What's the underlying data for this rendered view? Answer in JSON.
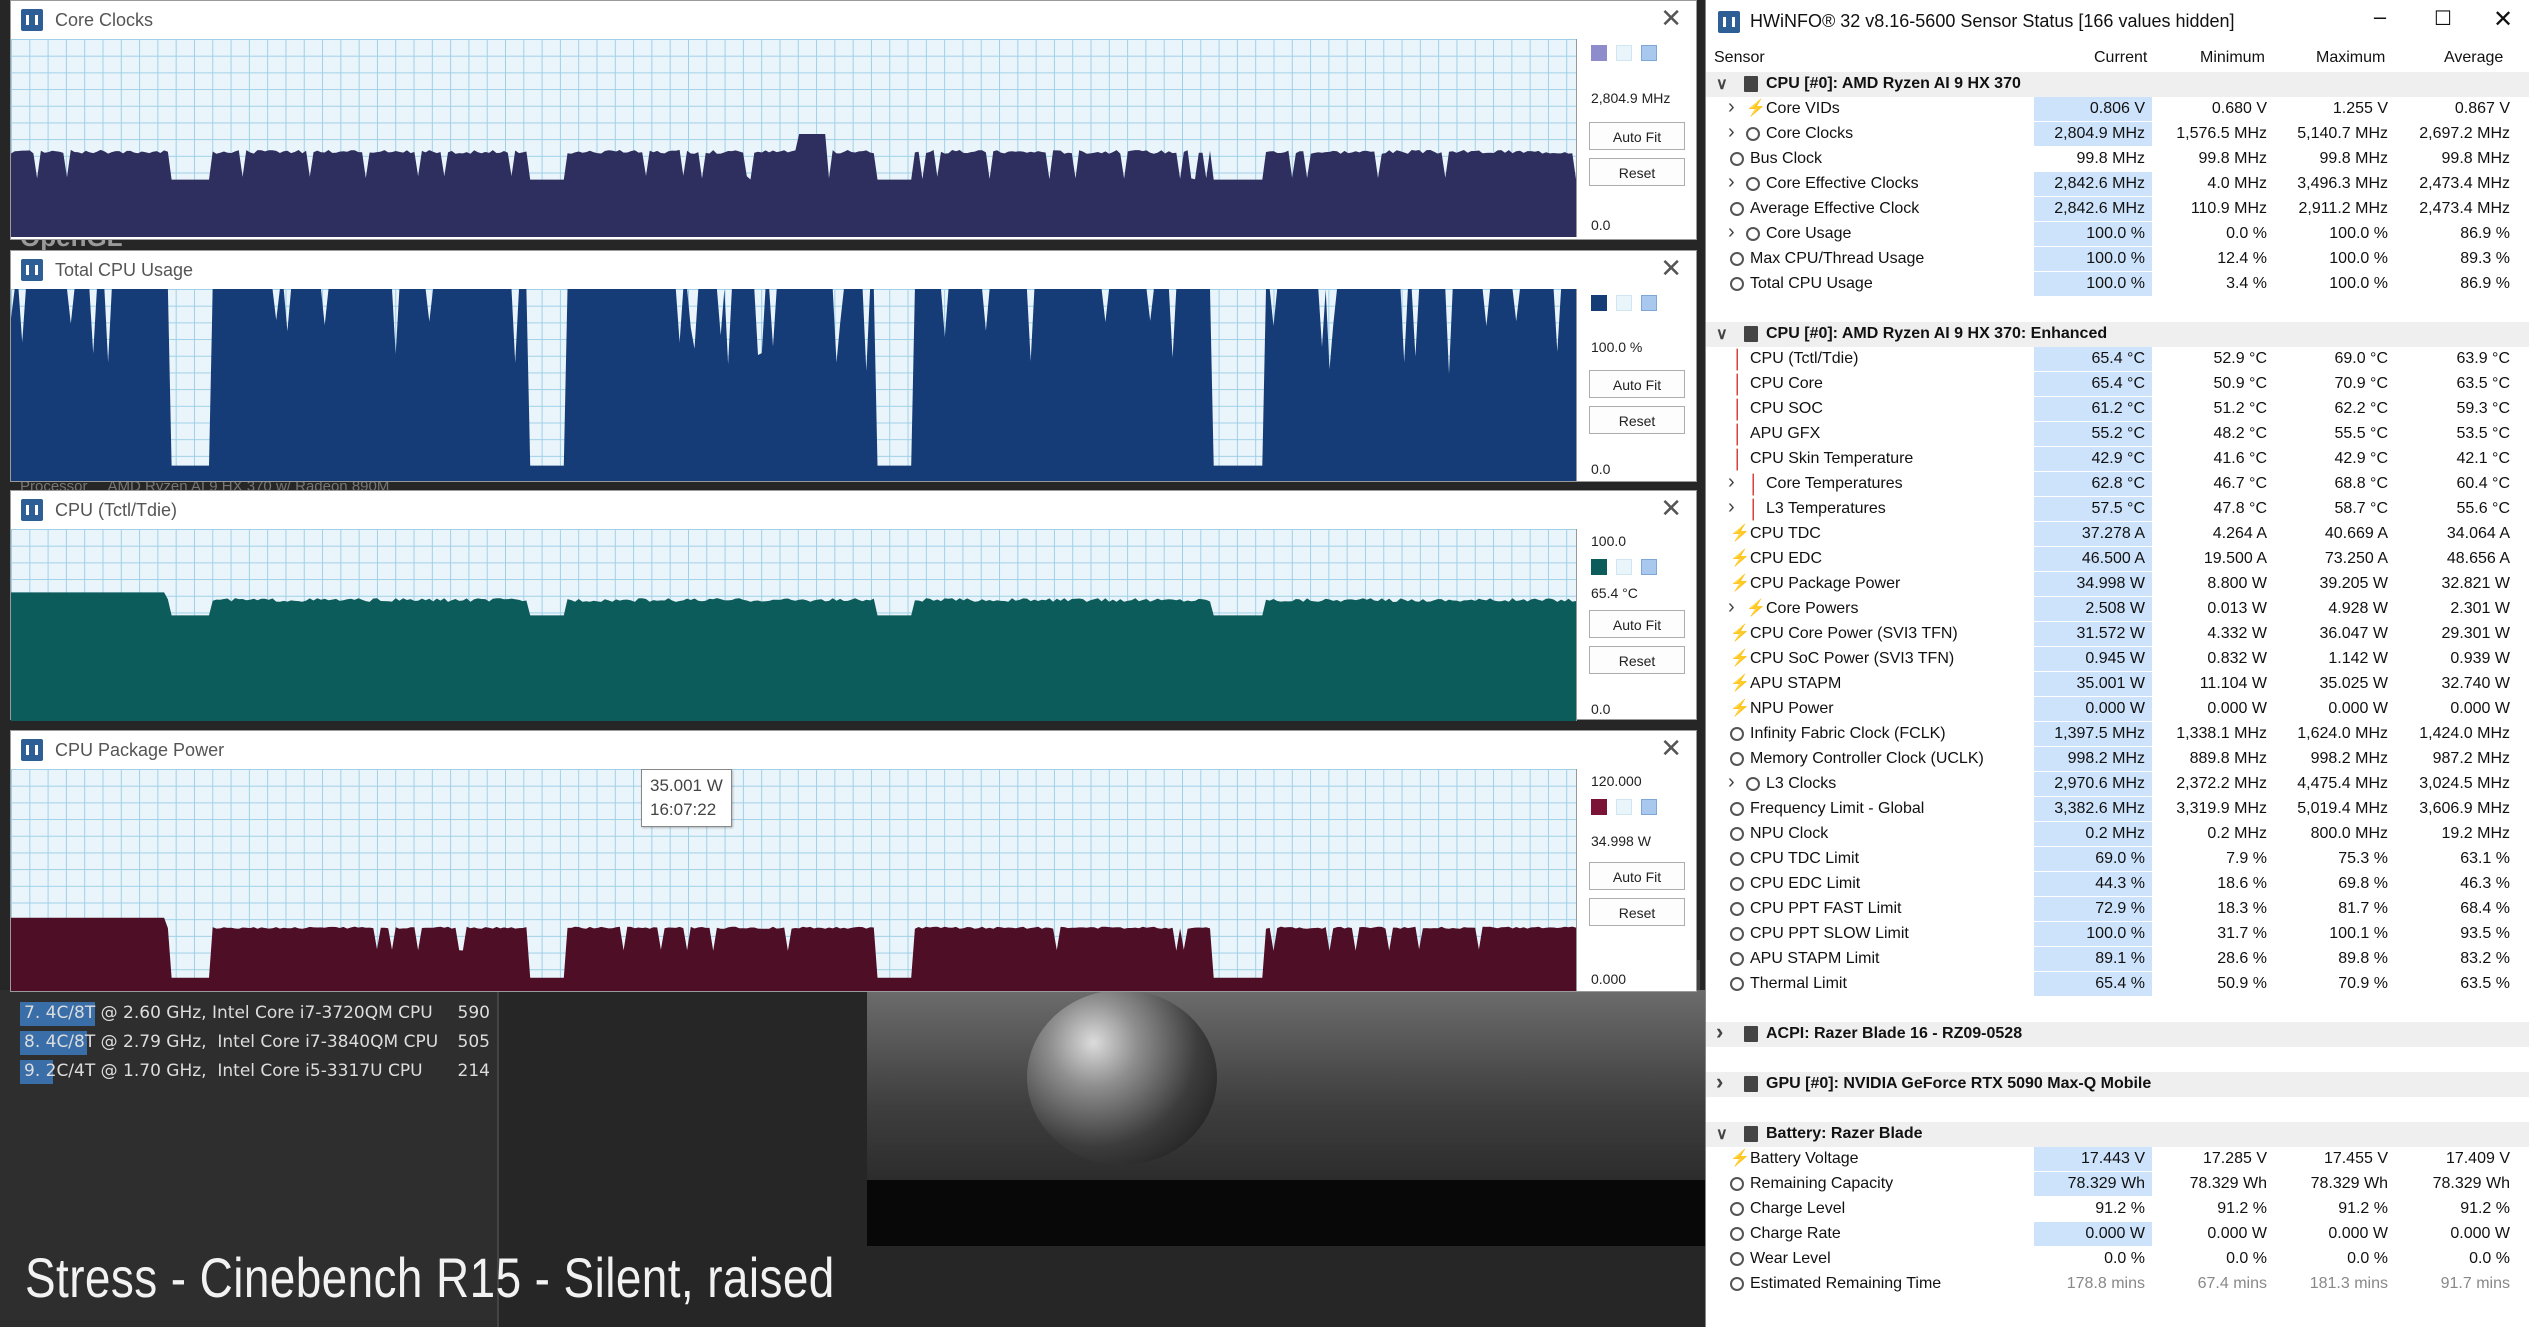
{
  "background": {
    "overlay_text": "Stress - Cinebench R15 - Silent, raised",
    "under_text_1": "OpenGL",
    "under_text_2": "Processor     AMD Ryzen AI 9 HX 370 w/ Radeon 890M",
    "ranking": [
      {
        "rank": "7.",
        "threads": "4C/8T",
        "label": " @ 2.60 GHz, Intel Core i7-3720QM CPU",
        "score": "590",
        "bar_fraction": 0.09
      },
      {
        "rank": "8.",
        "threads": "4C/8T",
        "label": " @ 2.79 GHz,  Intel Core i7-3840QM CPU",
        "score": "505",
        "bar_fraction": 0.08
      },
      {
        "rank": "9.",
        "threads": "2C/4T",
        "label": " @ 1.70 GHz,  Intel Core i5-3317U CPU",
        "score": "214",
        "bar_fraction": 0.04
      }
    ]
  },
  "graphs": [
    {
      "id": "clocks",
      "title": "Core Clocks",
      "max_label": "",
      "current": "2,804.9 MHz",
      "min_label": "0.0",
      "color": "#2e2f5e",
      "swatch": "#8e8ccc",
      "max_value": 3500,
      "current_value": 2804.9
    },
    {
      "id": "usage",
      "title": "Total CPU Usage",
      "max_label": "",
      "current": "100.0 %",
      "min_label": "0.0",
      "color": "#163c78",
      "swatch": "#163c78",
      "max_value": 100,
      "current_value": 100.0
    },
    {
      "id": "temp",
      "title": "CPU (Tctl/Tdie)",
      "max_label": "100.0",
      "current": "65.4 °C",
      "min_label": "0.0",
      "color": "#0c5c5c",
      "swatch": "#0c5c5c",
      "max_value": 100,
      "current_value": 65.4
    },
    {
      "id": "power",
      "title": "CPU Package Power",
      "max_label": "120.000",
      "current": "34.998 W",
      "min_label": "0.000",
      "color": "#4e0e26",
      "swatch": "#7a1336",
      "max_value": 120,
      "current_value": 34.998,
      "tooltip": {
        "value": "35.001 W",
        "time": "16:07:22"
      }
    }
  ],
  "graph_buttons": {
    "autofit": "Auto Fit",
    "reset": "Reset"
  },
  "hwinfo": {
    "title": "HWiNFO® 32 v8.16-5600 Sensor Status [166 values hidden]",
    "headers": {
      "sensor": "Sensor",
      "current": "Current",
      "minimum": "Minimum",
      "maximum": "Maximum",
      "average": "Average"
    },
    "rows": [
      {
        "type": "group",
        "expanded": true,
        "label": "CPU [#0]: AMD Ryzen AI 9 HX 370"
      },
      {
        "indent": 1,
        "expand": true,
        "icon": "bolt",
        "label": "Core VIDs",
        "cur": "0.806 V",
        "min": "0.680 V",
        "max": "1.255 V",
        "avg": "0.867 V"
      },
      {
        "indent": 1,
        "expand": true,
        "icon": "clock",
        "label": "Core Clocks",
        "cur": "2,804.9 MHz",
        "min": "1,576.5 MHz",
        "max": "5,140.7 MHz",
        "avg": "2,697.2 MHz"
      },
      {
        "indent": 0,
        "icon": "clock",
        "label": "Bus Clock",
        "cur": "99.8 MHz",
        "min": "99.8 MHz",
        "max": "99.8 MHz",
        "avg": "99.8 MHz"
      },
      {
        "indent": 1,
        "expand": true,
        "icon": "clock",
        "label": "Core Effective Clocks",
        "cur": "2,842.6 MHz",
        "min": "4.0 MHz",
        "max": "3,496.3 MHz",
        "avg": "2,473.4 MHz"
      },
      {
        "indent": 0,
        "icon": "clock",
        "label": "Average Effective Clock",
        "cur": "2,842.6 MHz",
        "min": "110.9 MHz",
        "max": "2,911.2 MHz",
        "avg": "2,473.4 MHz"
      },
      {
        "indent": 1,
        "expand": true,
        "icon": "clock",
        "label": "Core Usage",
        "cur": "100.0 %",
        "min": "0.0 %",
        "max": "100.0 %",
        "avg": "86.9 %"
      },
      {
        "indent": 0,
        "icon": "clock",
        "label": "Max CPU/Thread Usage",
        "cur": "100.0 %",
        "min": "12.4 %",
        "max": "100.0 %",
        "avg": "89.3 %"
      },
      {
        "indent": 0,
        "icon": "clock",
        "label": "Total CPU Usage",
        "cur": "100.0 %",
        "min": "3.4 %",
        "max": "100.0 %",
        "avg": "86.9 %"
      },
      {
        "type": "spacer"
      },
      {
        "type": "group",
        "expanded": true,
        "label": "CPU [#0]: AMD Ryzen AI 9 HX 370: Enhanced"
      },
      {
        "indent": 0,
        "icon": "therm",
        "label": "CPU (Tctl/Tdie)",
        "cur": "65.4 °C",
        "min": "52.9 °C",
        "max": "69.0 °C",
        "avg": "63.9 °C"
      },
      {
        "indent": 0,
        "icon": "therm",
        "label": "CPU Core",
        "cur": "65.4 °C",
        "min": "50.9 °C",
        "max": "70.9 °C",
        "avg": "63.5 °C"
      },
      {
        "indent": 0,
        "icon": "therm",
        "label": "CPU SOC",
        "cur": "61.2 °C",
        "min": "51.2 °C",
        "max": "62.2 °C",
        "avg": "59.3 °C"
      },
      {
        "indent": 0,
        "icon": "therm",
        "label": "APU GFX",
        "cur": "55.2 °C",
        "min": "48.2 °C",
        "max": "55.5 °C",
        "avg": "53.5 °C"
      },
      {
        "indent": 0,
        "icon": "therm",
        "label": "CPU Skin Temperature",
        "cur": "42.9 °C",
        "min": "41.6 °C",
        "max": "42.9 °C",
        "avg": "42.1 °C"
      },
      {
        "indent": 1,
        "expand": true,
        "icon": "therm",
        "label": "Core Temperatures",
        "cur": "62.8 °C",
        "min": "46.7 °C",
        "max": "68.8 °C",
        "avg": "60.4 °C"
      },
      {
        "indent": 1,
        "expand": true,
        "icon": "therm",
        "label": "L3 Temperatures",
        "cur": "57.5 °C",
        "min": "47.8 °C",
        "max": "58.7 °C",
        "avg": "55.6 °C"
      },
      {
        "indent": 0,
        "icon": "bolt",
        "label": "CPU TDC",
        "cur": "37.278 A",
        "min": "4.264 A",
        "max": "40.669 A",
        "avg": "34.064 A"
      },
      {
        "indent": 0,
        "icon": "bolt",
        "label": "CPU EDC",
        "cur": "46.500 A",
        "min": "19.500 A",
        "max": "73.250 A",
        "avg": "48.656 A"
      },
      {
        "indent": 0,
        "icon": "bolt",
        "label": "CPU Package Power",
        "cur": "34.998 W",
        "min": "8.800 W",
        "max": "39.205 W",
        "avg": "32.821 W"
      },
      {
        "indent": 1,
        "expand": true,
        "icon": "bolt",
        "label": "Core Powers",
        "cur": "2.508 W",
        "min": "0.013 W",
        "max": "4.928 W",
        "avg": "2.301 W"
      },
      {
        "indent": 0,
        "icon": "bolt",
        "label": "CPU Core Power (SVI3 TFN)",
        "cur": "31.572 W",
        "min": "4.332 W",
        "max": "36.047 W",
        "avg": "29.301 W"
      },
      {
        "indent": 0,
        "icon": "bolt",
        "label": "CPU SoC Power (SVI3 TFN)",
        "cur": "0.945 W",
        "min": "0.832 W",
        "max": "1.142 W",
        "avg": "0.939 W"
      },
      {
        "indent": 0,
        "icon": "bolt",
        "label": "APU STAPM",
        "cur": "35.001 W",
        "min": "11.104 W",
        "max": "35.025 W",
        "avg": "32.740 W"
      },
      {
        "indent": 0,
        "icon": "bolt",
        "label": "NPU Power",
        "cur": "0.000 W",
        "min": "0.000 W",
        "max": "0.000 W",
        "avg": "0.000 W"
      },
      {
        "indent": 0,
        "icon": "clock",
        "label": "Infinity Fabric Clock (FCLK)",
        "cur": "1,397.5 MHz",
        "min": "1,338.1 MHz",
        "max": "1,624.0 MHz",
        "avg": "1,424.0 MHz"
      },
      {
        "indent": 0,
        "icon": "clock",
        "label": "Memory Controller Clock (UCLK)",
        "cur": "998.2 MHz",
        "min": "889.8 MHz",
        "max": "998.2 MHz",
        "avg": "987.2 MHz"
      },
      {
        "indent": 1,
        "expand": true,
        "icon": "clock",
        "label": "L3 Clocks",
        "cur": "2,970.6 MHz",
        "min": "2,372.2 MHz",
        "max": "4,475.4 MHz",
        "avg": "3,024.5 MHz"
      },
      {
        "indent": 0,
        "icon": "clock",
        "label": "Frequency Limit - Global",
        "cur": "3,382.6 MHz",
        "min": "3,319.9 MHz",
        "max": "5,019.4 MHz",
        "avg": "3,606.9 MHz"
      },
      {
        "indent": 0,
        "icon": "clock",
        "label": "NPU Clock",
        "cur": "0.2 MHz",
        "min": "0.2 MHz",
        "max": "800.0 MHz",
        "avg": "19.2 MHz"
      },
      {
        "indent": 0,
        "icon": "clock",
        "label": "CPU TDC Limit",
        "cur": "69.0 %",
        "min": "7.9 %",
        "max": "75.3 %",
        "avg": "63.1 %"
      },
      {
        "indent": 0,
        "icon": "clock",
        "label": "CPU EDC Limit",
        "cur": "44.3 %",
        "min": "18.6 %",
        "max": "69.8 %",
        "avg": "46.3 %"
      },
      {
        "indent": 0,
        "icon": "clock",
        "label": "CPU PPT FAST Limit",
        "cur": "72.9 %",
        "min": "18.3 %",
        "max": "81.7 %",
        "avg": "68.4 %"
      },
      {
        "indent": 0,
        "icon": "clock",
        "label": "CPU PPT SLOW Limit",
        "cur": "100.0 %",
        "min": "31.7 %",
        "max": "100.1 %",
        "avg": "93.5 %"
      },
      {
        "indent": 0,
        "icon": "clock",
        "label": "APU STAPM Limit",
        "cur": "89.1 %",
        "min": "28.6 %",
        "max": "89.8 %",
        "avg": "83.2 %"
      },
      {
        "indent": 0,
        "icon": "clock",
        "label": "Thermal Limit",
        "cur": "65.4 %",
        "min": "50.9 %",
        "max": "70.9 %",
        "avg": "63.5 %"
      },
      {
        "type": "spacer"
      },
      {
        "type": "group",
        "expanded": false,
        "label": "ACPI: Razer Blade 16 - RZ09-0528"
      },
      {
        "type": "spacer"
      },
      {
        "type": "group",
        "expanded": false,
        "label": "GPU [#0]: NVIDIA  GeForce RTX 5090 Max-Q Mobile"
      },
      {
        "type": "spacer"
      },
      {
        "type": "group",
        "expanded": true,
        "label": "Battery: Razer Blade"
      },
      {
        "indent": 0,
        "icon": "bolt",
        "label": "Battery Voltage",
        "cur": "17.443 V",
        "min": "17.285 V",
        "max": "17.455 V",
        "avg": "17.409 V"
      },
      {
        "indent": 0,
        "icon": "clock",
        "label": "Remaining Capacity",
        "cur": "78.329 Wh",
        "min": "78.329 Wh",
        "max": "78.329 Wh",
        "avg": "78.329 Wh"
      },
      {
        "indent": 0,
        "icon": "clock",
        "label": "Charge Level",
        "cur": "91.2 %",
        "min": "91.2 %",
        "max": "91.2 %",
        "avg": "91.2 %"
      },
      {
        "indent": 0,
        "icon": "clock",
        "label": "Charge Rate",
        "cur": "0.000 W",
        "min": "0.000 W",
        "max": "0.000 W",
        "avg": "0.000 W"
      },
      {
        "indent": 0,
        "icon": "clock",
        "label": "Wear Level",
        "cur": "0.0 %",
        "min": "0.0 %",
        "max": "0.0 %",
        "avg": "0.0 %"
      },
      {
        "indent": 0,
        "icon": "clock",
        "dim": true,
        "label": "Estimated Remaining Time",
        "cur": "178.8 mins",
        "min": "67.4 mins",
        "max": "181.3 mins",
        "avg": "91.7 mins"
      }
    ],
    "highlight_current": [
      1,
      2,
      4,
      5,
      6,
      7,
      8,
      11,
      12,
      13,
      14,
      15,
      16,
      17,
      18,
      19,
      20,
      21,
      22,
      23,
      24,
      25,
      26,
      27,
      28,
      29,
      30,
      31,
      32,
      33,
      34,
      35,
      36,
      37,
      43,
      44,
      46
    ]
  }
}
